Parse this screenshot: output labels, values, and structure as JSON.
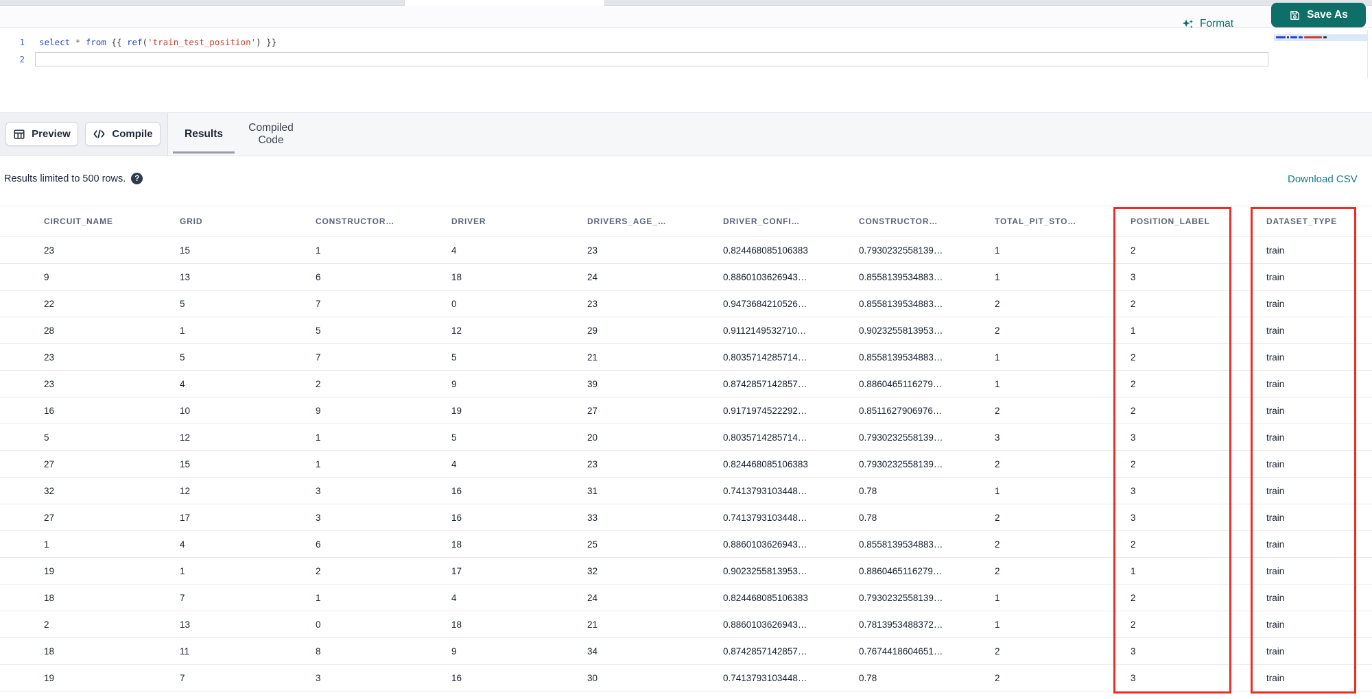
{
  "toolbar": {
    "format_label": "Format",
    "save_as_label": "Save As"
  },
  "editor": {
    "lines": [
      {
        "number": "1",
        "tokens": [
          {
            "t": "select",
            "c": "kw"
          },
          {
            "t": " ",
            "c": "pl"
          },
          {
            "t": "*",
            "c": "op"
          },
          {
            "t": " ",
            "c": "pl"
          },
          {
            "t": "from",
            "c": "kw"
          },
          {
            "t": " {{ ",
            "c": "pl"
          },
          {
            "t": "ref",
            "c": "kw"
          },
          {
            "t": "(",
            "c": "pl"
          },
          {
            "t": "'train_test_position'",
            "c": "str"
          },
          {
            "t": ")",
            "c": "pl"
          },
          {
            "t": " }}",
            "c": "pl"
          }
        ]
      },
      {
        "number": "2",
        "tokens": []
      }
    ]
  },
  "actions": {
    "preview_label": "Preview",
    "compile_label": "Compile"
  },
  "tabs": [
    {
      "label": "Results",
      "active": true
    },
    {
      "label": "Compiled Code",
      "active": false
    }
  ],
  "results": {
    "limit_notice": "Results limited to 500 rows.",
    "help_glyph": "?",
    "download_csv_label": "Download CSV"
  },
  "table": {
    "columns": [
      "CIRCUIT_NAME",
      "GRID",
      "CONSTRUCTOR…",
      "DRIVER",
      "DRIVERS_AGE_…",
      "DRIVER_CONFI…",
      "CONSTRUCTOR…",
      "TOTAL_PIT_STO…",
      "POSITION_LABEL",
      "DATASET_TYPE"
    ],
    "highlighted_columns": [
      "POSITION_LABEL",
      "DATASET_TYPE"
    ],
    "rows": [
      [
        "23",
        "15",
        "1",
        "4",
        "23",
        "0.824468085106383",
        "0.7930232558139…",
        "1",
        "2",
        "train"
      ],
      [
        "9",
        "13",
        "6",
        "18",
        "24",
        "0.8860103626943…",
        "0.8558139534883…",
        "1",
        "3",
        "train"
      ],
      [
        "22",
        "5",
        "7",
        "0",
        "23",
        "0.9473684210526…",
        "0.8558139534883…",
        "2",
        "2",
        "train"
      ],
      [
        "28",
        "1",
        "5",
        "12",
        "29",
        "0.9112149532710…",
        "0.9023255813953…",
        "2",
        "1",
        "train"
      ],
      [
        "23",
        "5",
        "7",
        "5",
        "21",
        "0.8035714285714…",
        "0.8558139534883…",
        "1",
        "2",
        "train"
      ],
      [
        "23",
        "4",
        "2",
        "9",
        "39",
        "0.8742857142857…",
        "0.8860465116279…",
        "1",
        "2",
        "train"
      ],
      [
        "16",
        "10",
        "9",
        "19",
        "27",
        "0.9171974522292…",
        "0.8511627906976…",
        "2",
        "2",
        "train"
      ],
      [
        "5",
        "12",
        "1",
        "5",
        "20",
        "0.8035714285714…",
        "0.7930232558139…",
        "3",
        "3",
        "train"
      ],
      [
        "27",
        "15",
        "1",
        "4",
        "23",
        "0.824468085106383",
        "0.7930232558139…",
        "2",
        "2",
        "train"
      ],
      [
        "32",
        "12",
        "3",
        "16",
        "31",
        "0.7413793103448…",
        "0.78",
        "1",
        "3",
        "train"
      ],
      [
        "27",
        "17",
        "3",
        "16",
        "33",
        "0.7413793103448…",
        "0.78",
        "2",
        "3",
        "train"
      ],
      [
        "1",
        "4",
        "6",
        "18",
        "25",
        "0.8860103626943…",
        "0.8558139534883…",
        "2",
        "2",
        "train"
      ],
      [
        "19",
        "1",
        "2",
        "17",
        "32",
        "0.9023255813953…",
        "0.8860465116279…",
        "2",
        "1",
        "train"
      ],
      [
        "18",
        "7",
        "1",
        "4",
        "24",
        "0.824468085106383",
        "0.7930232558139…",
        "1",
        "2",
        "train"
      ],
      [
        "2",
        "13",
        "0",
        "18",
        "21",
        "0.8860103626943…",
        "0.7813953488372…",
        "1",
        "2",
        "train"
      ],
      [
        "18",
        "11",
        "8",
        "9",
        "34",
        "0.8742857142857…",
        "0.7674418604651…",
        "2",
        "3",
        "train"
      ],
      [
        "19",
        "7",
        "3",
        "16",
        "30",
        "0.7413793103448…",
        "0.78",
        "2",
        "3",
        "train"
      ]
    ]
  },
  "colors": {
    "accent_teal": "#0d6f67",
    "link_teal": "#18798a",
    "highlight_red": "#ee2d20",
    "keyword_blue": "#2643d0",
    "string_red": "#cf3a30"
  }
}
